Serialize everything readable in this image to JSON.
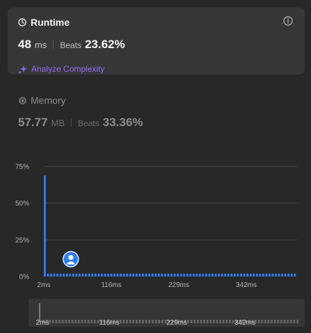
{
  "runtime": {
    "title": "Runtime",
    "value": "48",
    "unit": "ms",
    "beats_label": "Beats",
    "beats_value": "23.62%",
    "analyze_label": "Analyze Complexity",
    "icons": {
      "title": "clock-icon",
      "info": "info-icon",
      "analyze": "sparkle-icon"
    }
  },
  "memory": {
    "title": "Memory",
    "value": "57.77",
    "unit": "MB",
    "beats_label": "Beats",
    "beats_value": "33.36%",
    "icons": {
      "title": "chip-icon"
    }
  },
  "colors": {
    "accent_blue": "#2f7ff0",
    "analyze_purple": "#8f6cf7",
    "card_bg": "#373737",
    "page_bg": "#282828"
  },
  "chart_data": {
    "type": "bar",
    "y_ticks": [
      "75%",
      "50%",
      "25%",
      "0%"
    ],
    "x_ticks": [
      "2ms",
      "116ms",
      "229ms",
      "342ms"
    ],
    "ylim": [
      0,
      75
    ],
    "grid": true,
    "first_bar_value": 69,
    "small_bar_value": 2,
    "bar_count": 80,
    "user_marker_bar_index": 8
  },
  "scrubber": {
    "labels": [
      "2ms",
      "116ms",
      "229ms",
      "342ms"
    ]
  }
}
